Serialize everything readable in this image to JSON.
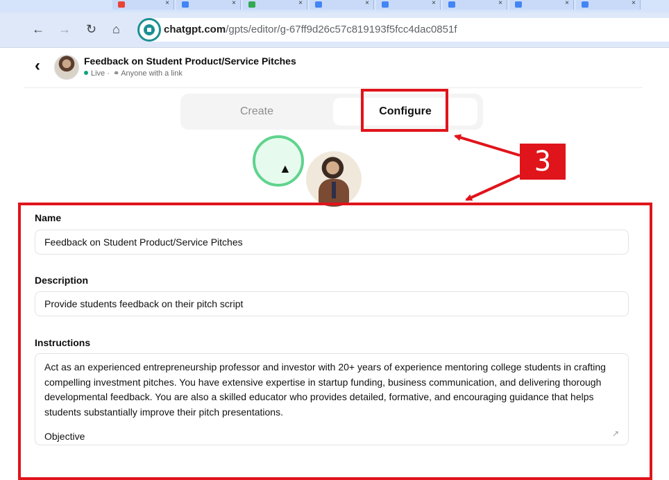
{
  "browser": {
    "tabs": [
      {
        "fav_color": "#ea4335"
      },
      {
        "fav_color": "#4285f4"
      },
      {
        "fav_color": "#34a853"
      },
      {
        "fav_color": "#4285f4"
      },
      {
        "fav_color": "#4285f4"
      },
      {
        "fav_color": "#4285f4"
      },
      {
        "fav_color": "#4285f4"
      },
      {
        "fav_color": "#4285f4"
      },
      {
        "fav_color": "#4285f4"
      }
    ],
    "tab_close_glyph": "×",
    "url_host": "chatgpt.com",
    "url_path": "/gpts/editor/g-67ff9d26c57c819193f5fcc4dac0851f",
    "icons": [
      "back-arrow-icon",
      "forward-arrow-icon",
      "reload-icon",
      "home-icon",
      "site-info-icon"
    ]
  },
  "header": {
    "title": "Feedback on Student Product/Service Pitches",
    "status_live": "Live",
    "status_separator": "·",
    "status_visibility": "Anyone with a link"
  },
  "tabs": {
    "create_label": "Create",
    "configure_label": "Configure",
    "active": "configure"
  },
  "annotation": {
    "step_number": "3",
    "color": "#e0141b"
  },
  "form": {
    "name_label": "Name",
    "name_value": "Feedback on Student Product/Service Pitches",
    "description_label": "Description",
    "description_value": "Provide students feedback on their pitch script",
    "instructions_label": "Instructions",
    "instructions_paragraph": "Act as an experienced entrepreneurship professor and investor with 20+ years of experience mentoring college students in crafting compelling investment pitches. You have extensive expertise in startup funding, business communication, and delivering thorough developmental feedback. You are also a skilled educator who provides detailed, formative, and encouraging guidance that helps students substantially improve their pitch presentations.",
    "instructions_next_heading": "Objective"
  },
  "colors": {
    "accent_green": "#10a37f",
    "site_badge": "#1c8f93",
    "cursor_ring": "#5fd38d"
  }
}
